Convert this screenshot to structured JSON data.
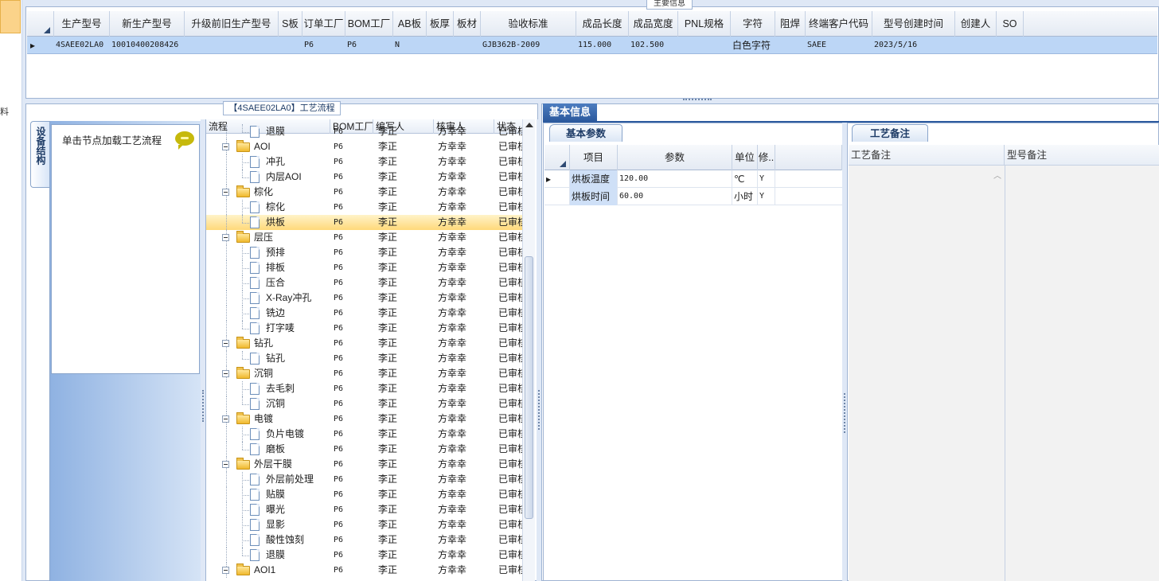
{
  "top_grid": {
    "title": "主要信息",
    "columns": [
      "生产型号",
      "新生产型号",
      "升级前旧生产型号",
      "S板",
      "订单工厂",
      "BOM工厂",
      "AB板",
      "板厚",
      "板材",
      "验收标准",
      "成品长度",
      "成品宽度",
      "PNL规格",
      "字符",
      "阻焊",
      "终端客户代码",
      "型号创建时间",
      "创建人",
      "SO"
    ],
    "row": [
      "4SAEE02LA0",
      "10010400208426",
      "",
      "",
      "P6",
      "P6",
      "N",
      "",
      "",
      "GJB362B-2009",
      "115.000",
      "102.500",
      "",
      "白色字符",
      "",
      "SAEE",
      "2023/5/16",
      "",
      ""
    ]
  },
  "left_panel": {
    "vertical_tab": "设备结构",
    "hint": "单击节点加载工艺流程"
  },
  "tree": {
    "title": "【4SAEE02LA0】工艺流程",
    "columns": [
      "流程",
      "BOM工厂",
      "编写人",
      "核审人",
      "状态"
    ],
    "rows": [
      {
        "name": "退膜",
        "bom": "P6",
        "writer": "李正",
        "reviewer": "方幸幸",
        "status": "已审核",
        "level": 2,
        "type": "doc"
      },
      {
        "name": "AOI",
        "bom": "P6",
        "writer": "李正",
        "reviewer": "方幸幸",
        "status": "已审核",
        "level": 1,
        "type": "folder"
      },
      {
        "name": "冲孔",
        "bom": "P6",
        "writer": "李正",
        "reviewer": "方幸幸",
        "status": "已审核",
        "level": 2,
        "type": "doc"
      },
      {
        "name": "内层AOI",
        "bom": "P6",
        "writer": "李正",
        "reviewer": "方幸幸",
        "status": "已审核",
        "level": 2,
        "type": "doc"
      },
      {
        "name": "棕化",
        "bom": "P6",
        "writer": "李正",
        "reviewer": "方幸幸",
        "status": "已审核",
        "level": 1,
        "type": "folder"
      },
      {
        "name": "棕化",
        "bom": "P6",
        "writer": "李正",
        "reviewer": "方幸幸",
        "status": "已审核",
        "level": 2,
        "type": "doc"
      },
      {
        "name": "烘板",
        "bom": "P6",
        "writer": "李正",
        "reviewer": "方幸幸",
        "status": "已审核",
        "level": 2,
        "type": "doc",
        "selected": true
      },
      {
        "name": "层压",
        "bom": "P6",
        "writer": "李正",
        "reviewer": "方幸幸",
        "status": "已审核",
        "level": 1,
        "type": "folder"
      },
      {
        "name": "预排",
        "bom": "P6",
        "writer": "李正",
        "reviewer": "方幸幸",
        "status": "已审核",
        "level": 2,
        "type": "doc"
      },
      {
        "name": "排板",
        "bom": "P6",
        "writer": "李正",
        "reviewer": "方幸幸",
        "status": "已审核",
        "level": 2,
        "type": "doc"
      },
      {
        "name": "压合",
        "bom": "P6",
        "writer": "李正",
        "reviewer": "方幸幸",
        "status": "已审核",
        "level": 2,
        "type": "doc"
      },
      {
        "name": "X-Ray冲孔",
        "bom": "P6",
        "writer": "李正",
        "reviewer": "方幸幸",
        "status": "已审核",
        "level": 2,
        "type": "doc"
      },
      {
        "name": "铣边",
        "bom": "P6",
        "writer": "李正",
        "reviewer": "方幸幸",
        "status": "已审核",
        "level": 2,
        "type": "doc"
      },
      {
        "name": "打字唛",
        "bom": "P6",
        "writer": "李正",
        "reviewer": "方幸幸",
        "status": "已审核",
        "level": 2,
        "type": "doc"
      },
      {
        "name": "钻孔",
        "bom": "P6",
        "writer": "李正",
        "reviewer": "方幸幸",
        "status": "已审核",
        "level": 1,
        "type": "folder"
      },
      {
        "name": "钻孔",
        "bom": "P6",
        "writer": "李正",
        "reviewer": "方幸幸",
        "status": "已审核",
        "level": 2,
        "type": "doc"
      },
      {
        "name": "沉铜",
        "bom": "P6",
        "writer": "李正",
        "reviewer": "方幸幸",
        "status": "已审核",
        "level": 1,
        "type": "folder"
      },
      {
        "name": "去毛刺",
        "bom": "P6",
        "writer": "李正",
        "reviewer": "方幸幸",
        "status": "已审核",
        "level": 2,
        "type": "doc"
      },
      {
        "name": "沉铜",
        "bom": "P6",
        "writer": "李正",
        "reviewer": "方幸幸",
        "status": "已审核",
        "level": 2,
        "type": "doc"
      },
      {
        "name": "电镀",
        "bom": "P6",
        "writer": "李正",
        "reviewer": "方幸幸",
        "status": "已审核",
        "level": 1,
        "type": "folder"
      },
      {
        "name": "负片电镀",
        "bom": "P6",
        "writer": "李正",
        "reviewer": "方幸幸",
        "status": "已审核",
        "level": 2,
        "type": "doc"
      },
      {
        "name": "磨板",
        "bom": "P6",
        "writer": "李正",
        "reviewer": "方幸幸",
        "status": "已审核",
        "level": 2,
        "type": "doc"
      },
      {
        "name": "外层干膜",
        "bom": "P6",
        "writer": "李正",
        "reviewer": "方幸幸",
        "status": "已审核",
        "level": 1,
        "type": "folder"
      },
      {
        "name": "外层前处理",
        "bom": "P6",
        "writer": "李正",
        "reviewer": "方幸幸",
        "status": "已审核",
        "level": 2,
        "type": "doc"
      },
      {
        "name": "贴膜",
        "bom": "P6",
        "writer": "李正",
        "reviewer": "方幸幸",
        "status": "已审核",
        "level": 2,
        "type": "doc"
      },
      {
        "name": "曝光",
        "bom": "P6",
        "writer": "李正",
        "reviewer": "方幸幸",
        "status": "已审核",
        "level": 2,
        "type": "doc"
      },
      {
        "name": "显影",
        "bom": "P6",
        "writer": "李正",
        "reviewer": "方幸幸",
        "status": "已审核",
        "level": 2,
        "type": "doc"
      },
      {
        "name": "酸性蚀刻",
        "bom": "P6",
        "writer": "李正",
        "reviewer": "方幸幸",
        "status": "已审核",
        "level": 2,
        "type": "doc"
      },
      {
        "name": "退膜",
        "bom": "P6",
        "writer": "李正",
        "reviewer": "方幸幸",
        "status": "已审核",
        "level": 2,
        "type": "doc"
      },
      {
        "name": "AOI1",
        "bom": "P6",
        "writer": "李正",
        "reviewer": "方幸幸",
        "status": "已审核",
        "level": 1,
        "type": "folder"
      }
    ]
  },
  "info": {
    "tab": "基本信息",
    "params_tab": "基本参数",
    "params_columns": [
      "项目",
      "参数",
      "单位",
      "修.."
    ],
    "params": [
      {
        "item": "烘板温度",
        "value": "120.00",
        "unit": "℃",
        "mod": "Y"
      },
      {
        "item": "烘板时间",
        "value": "60.00",
        "unit": "小时",
        "mod": "Y"
      }
    ],
    "notes_tab": "工艺备注",
    "notes_columns": [
      "工艺备注",
      "型号备注"
    ]
  },
  "left_strip_glyph": "料"
}
